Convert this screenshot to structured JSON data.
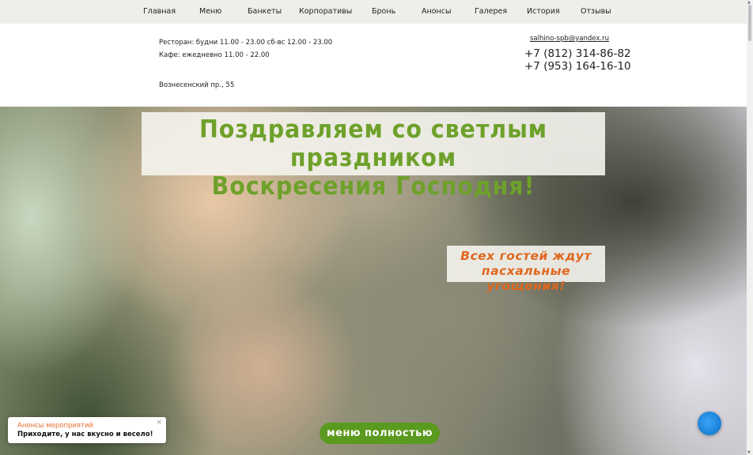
{
  "nav": {
    "items": [
      "Главная",
      "Меню",
      "Банкеты",
      "Корпоративы",
      "Бронь",
      "Анонсы",
      "Галерея",
      "История",
      "Отзывы"
    ]
  },
  "header": {
    "hours_restaurant": "Ресторан: будни 11.00 - 23.00 сб-вс 12.00 - 23.00",
    "hours_cafe": "Кафе: ежедневно 11.00 - 22.00",
    "address": "Вознесенский пр., 55",
    "email": "salhino-spb@yandex.ru",
    "phone_1": "+7 (812) 314-86-82",
    "phone_2": "+7 (953) 164-16-10"
  },
  "hero": {
    "greeting_line_1": "Поздравляем со светлым праздником",
    "greeting_line_2": "Воскресения Господня!",
    "offer_line_1": "Всех гостей ждут",
    "offer_line_2": "пасхальные угощения!",
    "menu_button": "меню полностью"
  },
  "notice": {
    "title": "Анонсы мероприятий",
    "text": "Приходите, у нас вкусно и весело!",
    "close": "×"
  },
  "colors": {
    "accent_green": "#6ea12a",
    "button_green": "#5a9a1e",
    "accent_orange": "#e0671e",
    "chat_blue": "#1a7fd6"
  }
}
